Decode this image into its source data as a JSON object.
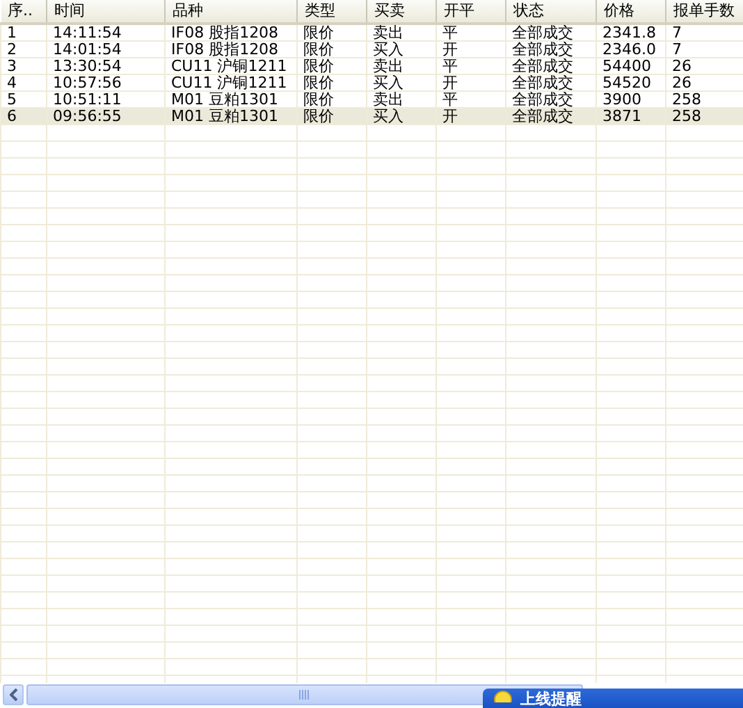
{
  "table": {
    "columns": [
      "序..",
      "时间",
      "品种",
      "类型",
      "买卖",
      "开平",
      "状态",
      "价格",
      "报单手数"
    ],
    "rows": [
      {
        "cells": [
          "1",
          "14:11:54",
          "IF08 股指1208",
          "限价",
          "卖出",
          "平",
          "全部成交",
          "2341.8",
          "7"
        ],
        "selected": false
      },
      {
        "cells": [
          "2",
          "14:01:54",
          "IF08 股指1208",
          "限价",
          "买入",
          "开",
          "全部成交",
          "2346.0",
          "7"
        ],
        "selected": false
      },
      {
        "cells": [
          "3",
          "13:30:54",
          "CU11 沪铜1211",
          "限价",
          "卖出",
          "平",
          "全部成交",
          "54400",
          "26"
        ],
        "selected": false
      },
      {
        "cells": [
          "4",
          "10:57:56",
          "CU11 沪铜1211",
          "限价",
          "买入",
          "开",
          "全部成交",
          "54520",
          "26"
        ],
        "selected": false
      },
      {
        "cells": [
          "5",
          "10:51:11",
          "M01 豆粕1301",
          "限价",
          "卖出",
          "平",
          "全部成交",
          "3900",
          "258"
        ],
        "selected": false
      },
      {
        "cells": [
          "6",
          "09:56:55",
          "M01 豆粕1301",
          "限价",
          "买入",
          "开",
          "全部成交",
          "3871",
          "258"
        ],
        "selected": true
      }
    ]
  },
  "popup": {
    "title": "上线提醒"
  }
}
